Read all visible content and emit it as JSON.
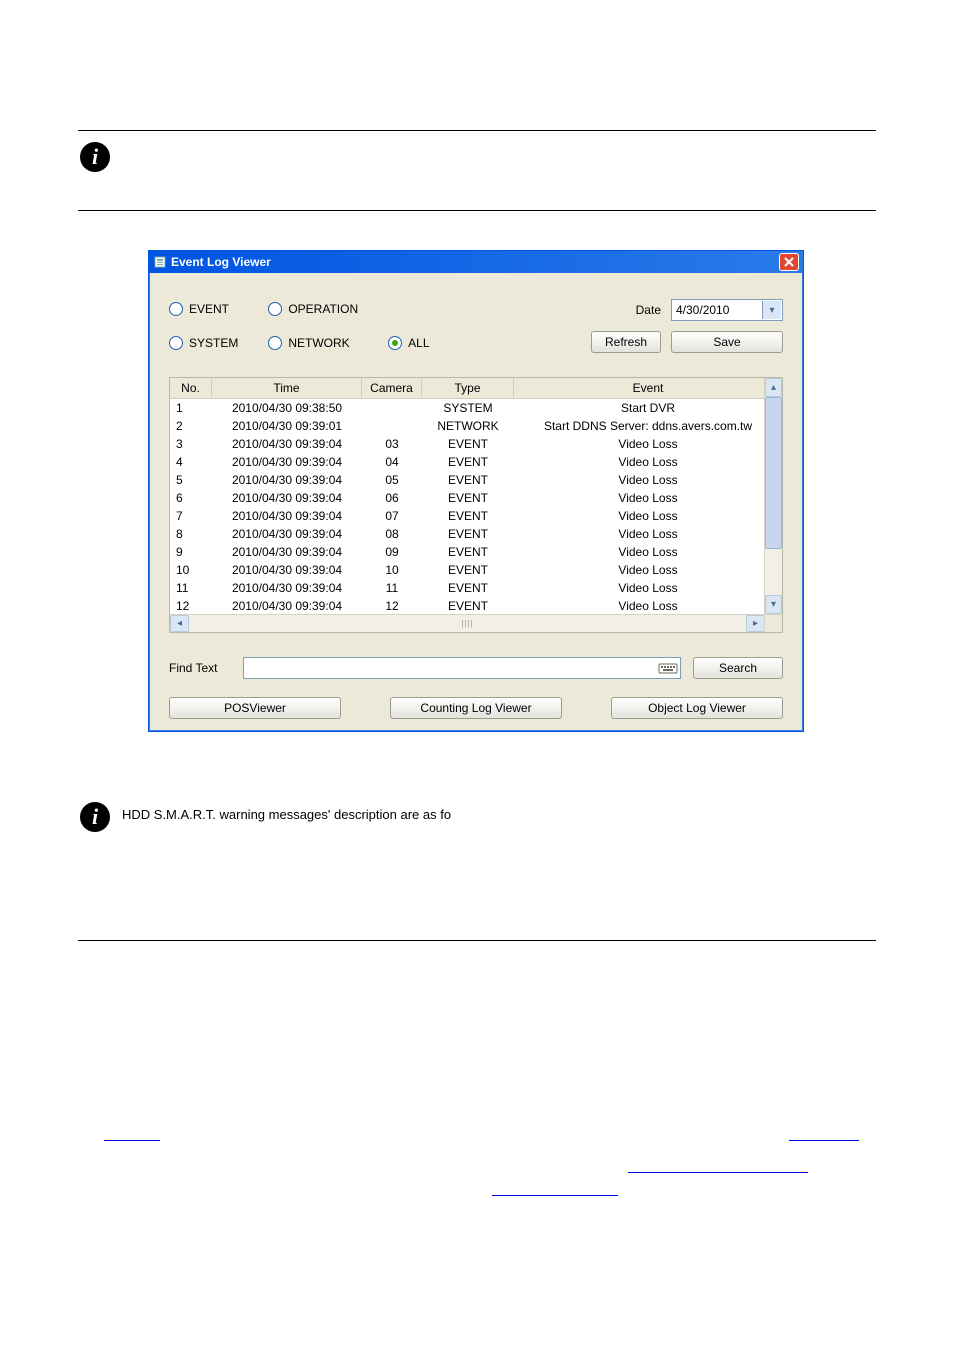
{
  "window": {
    "title": "Event Log Viewer"
  },
  "filters": {
    "radios": {
      "event": "EVENT",
      "operation": "OPERATION",
      "system": "SYSTEM",
      "network": "NETWORK",
      "all": "ALL"
    },
    "selected": "ALL",
    "date_label": "Date",
    "date_value": "4/30/2010",
    "refresh": "Refresh",
    "save": "Save"
  },
  "table": {
    "headers": {
      "no": "No.",
      "time": "Time",
      "camera": "Camera",
      "type": "Type",
      "event": "Event"
    },
    "rows": [
      {
        "no": "1",
        "time": "2010/04/30 09:38:50",
        "camera": "",
        "type": "SYSTEM",
        "event": "Start DVR"
      },
      {
        "no": "2",
        "time": "2010/04/30 09:39:01",
        "camera": "",
        "type": "NETWORK",
        "event": "Start DDNS Server: ddns.avers.com.tw"
      },
      {
        "no": "3",
        "time": "2010/04/30 09:39:04",
        "camera": "03",
        "type": "EVENT",
        "event": "Video Loss"
      },
      {
        "no": "4",
        "time": "2010/04/30 09:39:04",
        "camera": "04",
        "type": "EVENT",
        "event": "Video Loss"
      },
      {
        "no": "5",
        "time": "2010/04/30 09:39:04",
        "camera": "05",
        "type": "EVENT",
        "event": "Video Loss"
      },
      {
        "no": "6",
        "time": "2010/04/30 09:39:04",
        "camera": "06",
        "type": "EVENT",
        "event": "Video Loss"
      },
      {
        "no": "7",
        "time": "2010/04/30 09:39:04",
        "camera": "07",
        "type": "EVENT",
        "event": "Video Loss"
      },
      {
        "no": "8",
        "time": "2010/04/30 09:39:04",
        "camera": "08",
        "type": "EVENT",
        "event": "Video Loss"
      },
      {
        "no": "9",
        "time": "2010/04/30 09:39:04",
        "camera": "09",
        "type": "EVENT",
        "event": "Video Loss"
      },
      {
        "no": "10",
        "time": "2010/04/30 09:39:04",
        "camera": "10",
        "type": "EVENT",
        "event": "Video Loss"
      },
      {
        "no": "11",
        "time": "2010/04/30 09:39:04",
        "camera": "11",
        "type": "EVENT",
        "event": "Video Loss"
      },
      {
        "no": "12",
        "time": "2010/04/30 09:39:04",
        "camera": "12",
        "type": "EVENT",
        "event": "Video Loss"
      }
    ]
  },
  "find": {
    "label": "Find Text",
    "value": "",
    "search": "Search"
  },
  "buttons": {
    "posviewer": "POSViewer",
    "counting": "Counting Log Viewer",
    "object": "Object Log Viewer"
  },
  "note": "HDD S.M.A.R.T. warning messages' description are as fo"
}
